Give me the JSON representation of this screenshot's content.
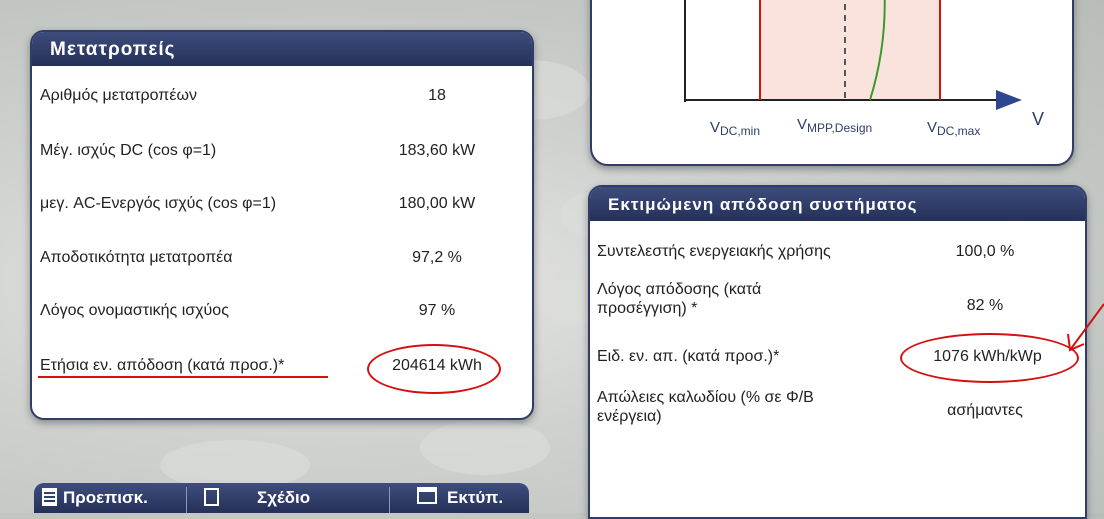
{
  "inverters": {
    "title": "Μετατροπείς",
    "rows": [
      {
        "label": "Αριθμός μετατροπέων",
        "value": "18"
      },
      {
        "label": "Μέγ. ισχύς DC (cos φ=1)",
        "value": "183,60 kW"
      },
      {
        "label": "μεγ. AC-Ενεργός ισχύς (cos φ=1)",
        "value": "180,00 kW"
      },
      {
        "label": "Αποδοτικότητα μετατροπέα",
        "value": "97,2 %"
      },
      {
        "label": "Λόγος ονομαστικής ισχύος",
        "value": "97 %"
      },
      {
        "label": "Ετήσια εν. απόδοση (κατά προσ.)*",
        "value": "204614 kWh"
      }
    ]
  },
  "performance": {
    "title": "Εκτιμώμενη απόδοση συστήματος",
    "rows": [
      {
        "label": "Συντελεστής ενεργειακής χρήσης",
        "value": "100,0 %"
      },
      {
        "label": "Λόγος απόδοσης (κατά προσέγγιση) *",
        "value": "82 %"
      },
      {
        "label": "Ειδ. εν. απ. (κατά προσ.)*",
        "value": "1076 kWh/kWp"
      },
      {
        "label": "Απώλειες καλωδίου (% σε Φ/Β ενέργεια)",
        "value": "ασήμαντες"
      }
    ]
  },
  "diagram": {
    "x_axis_label": "V",
    "tick_vdc_min_main": "V",
    "tick_vdc_min_sub": "DC,min",
    "tick_vmpp_main": "V",
    "tick_vmpp_sub": "MPP,Design",
    "tick_vdc_max_main": "V",
    "tick_vdc_max_sub": "DC,max"
  },
  "buttons": {
    "preview": "Προεπισκ.",
    "design": "Σχέδιο",
    "print": "Εκτύπ."
  },
  "colors": {
    "header": "#2f3d68",
    "annotation": "#d41010"
  }
}
